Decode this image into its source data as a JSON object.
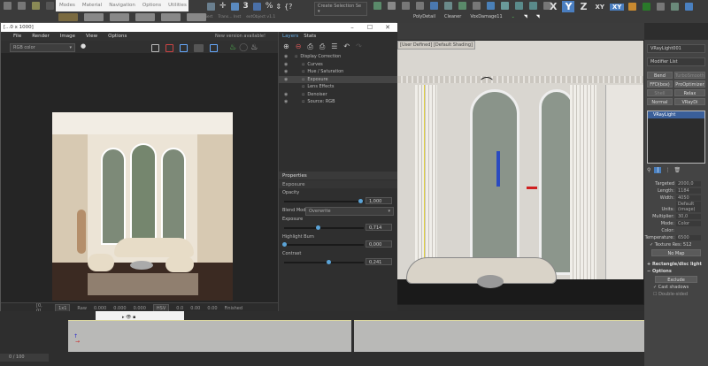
{
  "top_menu": {
    "items": [
      "Modes",
      "Material",
      "Navigation",
      "Options",
      "Utilities"
    ]
  },
  "toolbar": {
    "selection_set": "Create Selection Se",
    "scripts": [
      "PolyDetail",
      "Cleaner",
      "VoxDamage11"
    ],
    "axes": [
      "X",
      "Y",
      "Z",
      "XY",
      "XY"
    ],
    "small_labels": [
      "Isoliert",
      "Trans... Inst",
      "extObject v1.1"
    ]
  },
  "vfb": {
    "title": "[...0 x 1000]",
    "menu": [
      "File",
      "Render",
      "Image",
      "View",
      "Options"
    ],
    "notice": "New version available!",
    "channel": "RGB color",
    "layers_tabs": [
      "Layers",
      "Stats"
    ],
    "layers": [
      {
        "label": "Display Correction",
        "visible": true,
        "selected": false,
        "indent": 0
      },
      {
        "label": "Curves",
        "visible": true,
        "selected": false,
        "indent": 1
      },
      {
        "label": "Hue / Saturation",
        "visible": true,
        "selected": false,
        "indent": 1
      },
      {
        "label": "Exposure",
        "visible": true,
        "selected": true,
        "indent": 1
      },
      {
        "label": "Lens Effects",
        "visible": false,
        "selected": false,
        "indent": 1
      },
      {
        "label": "Denoiser",
        "visible": true,
        "selected": false,
        "indent": 1
      },
      {
        "label": "Source: RGB",
        "visible": true,
        "selected": false,
        "indent": 1
      }
    ],
    "properties": {
      "header": "Properties",
      "section": "Exposure",
      "opacity_label": "Opacity",
      "opacity": "1,000",
      "opacity_frac": 0.95,
      "blend_label": "Blend Mode",
      "blend_mode": "Overwrite",
      "exposure_label": "Exposure",
      "exposure": "0,714",
      "exposure_frac": 0.42,
      "highlight_label": "Highlight Burn",
      "highlight": "0,000",
      "highlight_frac": 0.0,
      "contrast_label": "Contrast",
      "contrast": "0,241",
      "contrast_frac": 0.55
    },
    "status": {
      "coords": "[0, 0]",
      "zoom": "1x1",
      "raw": "Raw",
      "values": [
        "0.000",
        "0.000",
        "0.000"
      ],
      "mode": "HSV",
      "hsv": [
        "0.0",
        "0.00",
        "0.00"
      ],
      "format": "Finished"
    }
  },
  "viewport": {
    "label": "[User Defined] [Default Shading]"
  },
  "command_panel": {
    "object_name": "VRayLight001",
    "modifier_list": "Modifier List",
    "buttons": [
      "Bend",
      "TurboSmooth",
      "FFD(box)",
      "ProOptimizer",
      "Shell",
      "Relax",
      "Normal",
      "VRayDi"
    ],
    "stack_item": "VRayLight",
    "params": [
      {
        "label": "Targeted",
        "value": "2000,0"
      },
      {
        "label": "Length:",
        "value": "1184"
      },
      {
        "label": "Width:",
        "value": "4050"
      },
      {
        "label": "Units:",
        "value": "Default (image)"
      },
      {
        "label": "Multiplier:",
        "value": "30,0"
      },
      {
        "label": "Mode:",
        "value": "Color"
      },
      {
        "label": "Color:",
        "value": ""
      },
      {
        "label": "Temperature:",
        "value": "6500"
      }
    ],
    "texture_label": "Texture",
    "res_label": "Res:",
    "res": "512",
    "no_map": "No Map",
    "rollouts": [
      "Rectangle/disc light",
      "Options"
    ],
    "exclude": "Exclude",
    "cast_shadows": "Cast shadows",
    "double_sided": "Double-sided"
  },
  "timeline": {
    "frame": "0 / 100"
  }
}
